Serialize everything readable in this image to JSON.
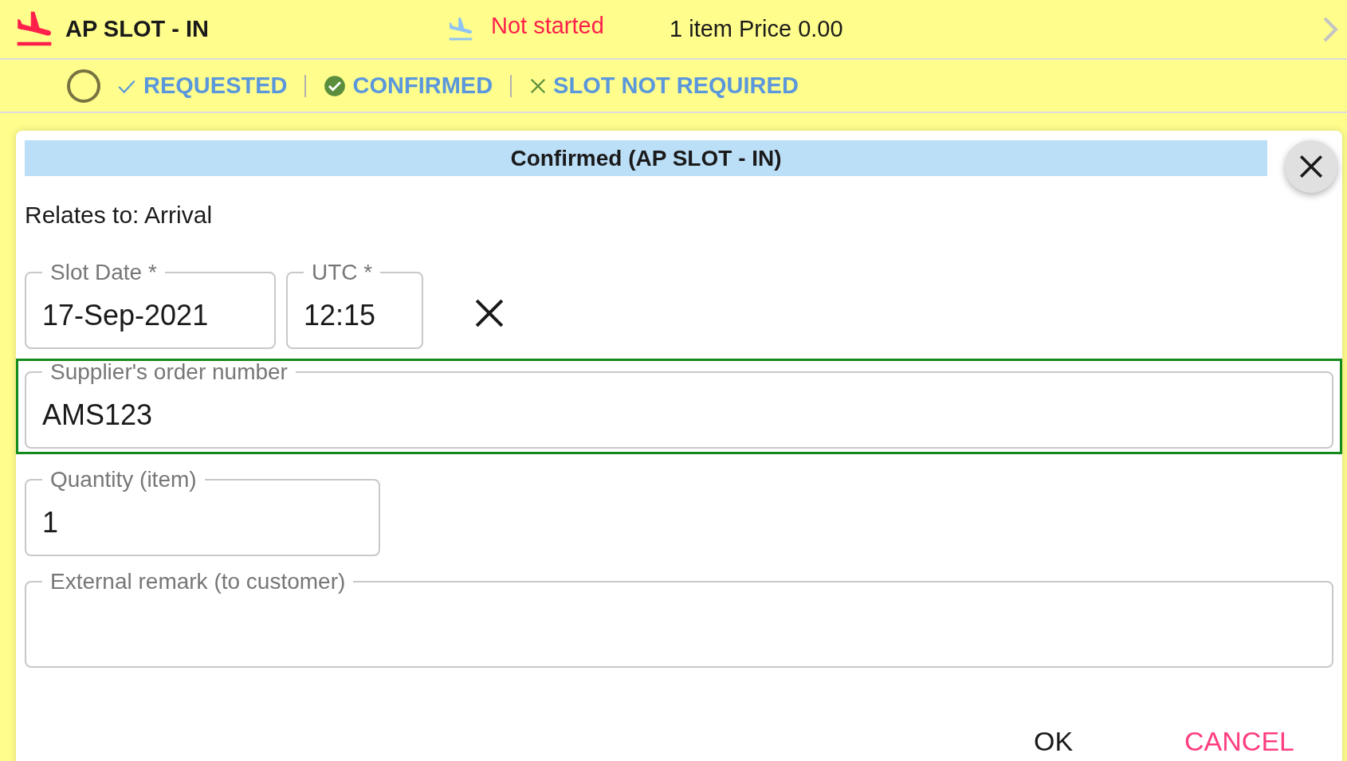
{
  "header": {
    "title": "AP SLOT - IN",
    "status": "Not started",
    "summary": "1 item Price 0.00"
  },
  "status_options": [
    {
      "kind": "requested",
      "label": "REQUESTED",
      "selected": false
    },
    {
      "kind": "confirmed",
      "label": "CONFIRMED",
      "selected": true
    },
    {
      "kind": "not_required",
      "label": "SLOT NOT REQUIRED",
      "selected": false
    }
  ],
  "dialog": {
    "title": "Confirmed (AP SLOT - IN)",
    "relates_to": "Relates to: Arrival",
    "fields": [
      {
        "label": "Slot Date *",
        "value": "17-Sep-2021",
        "focused": false
      },
      {
        "label": "UTC *",
        "value": "12:15",
        "focused": false
      },
      {
        "label": "Supplier's order number",
        "value": "AMS123",
        "focused": true
      },
      {
        "label": "Quantity (item)",
        "value": "1",
        "focused": false
      },
      {
        "label": "External remark (to customer)",
        "focused": false
      }
    ],
    "buttons": [
      {
        "kind": "ok",
        "label": "OK"
      },
      {
        "kind": "cancel",
        "label": "CANCEL"
      }
    ]
  }
}
